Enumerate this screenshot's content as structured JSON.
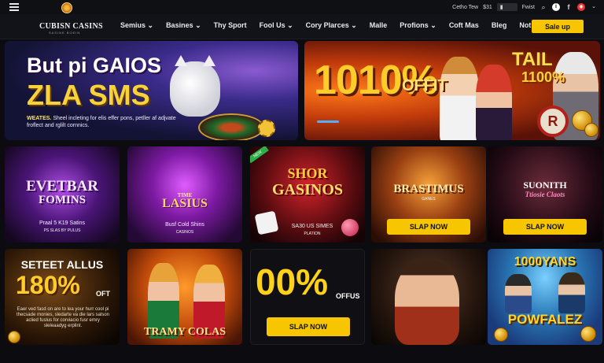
{
  "topbar": {
    "right_text_1": "Cetho Tew",
    "right_text_2": "$31",
    "right_text_3": "Fwist",
    "icons": [
      "menu-icon",
      "search-icon",
      "info-icon",
      "facebook-icon",
      "globe-icon",
      "chevron-down-icon"
    ]
  },
  "nav": {
    "brand": "CUBISN CASINS",
    "brand_sub": "SASINE BOEIN",
    "items": [
      "Semius ⌄",
      "Basines ⌄",
      "Thy Sport",
      "Fool Us ⌄",
      "Cory Plarces ⌄",
      "Malle",
      "Profions ⌄",
      "Coft Mas",
      "Bleg",
      "Not Flous"
    ],
    "signup": "Sale up"
  },
  "hero_left": {
    "title1": "But pi GAIOS",
    "title2": "ZLA SMS",
    "desc_bold": "WEATES.",
    "desc": " Sheel incleting for elis effer pons, petller af adjvate froflect and rglilt cornnics."
  },
  "hero_right": {
    "big": "1010%",
    "offit": "OFFIT",
    "badge1": "TAIL",
    "badge2": "1100%",
    "chip": "R"
  },
  "cards": [
    {
      "title": "EVETBAR",
      "title2": "FOMINS",
      "sub": "Praal 5 K19 Satins",
      "sub2": "PS SLAS BY PULUS"
    },
    {
      "title": "TIME",
      "title2": "LASIUS",
      "sub": "Busf Cold Shins",
      "sub2": "CASINOS"
    },
    {
      "title": "SHOR",
      "title2": "GASINOS",
      "sub": "SA30 US SIMES",
      "sub2": "PLATION",
      "tag": "NEW"
    },
    {
      "title": "BRASTIMUS",
      "title2": "GANES",
      "button": "SLAP NOW"
    },
    {
      "title": "SUONITH",
      "title2": "Ttiosie Claots",
      "button": "SLAP NOW"
    },
    {
      "title": "SETEET ALLUS",
      "title2": "180%",
      "title3": "OFT",
      "desc": "Eaer ved fasd on are to lea your hurr cool pi thecsade monies, sledarte va die lars salson aclied fuslus for corviacio fusr emry sleleaadyg erplint."
    },
    {
      "title": "TRAMY COLAS"
    },
    {
      "title": "00%",
      "title2": "OFFUS",
      "button": "SLAP NOW"
    },
    {
      "title": ""
    },
    {
      "title": "1000YANS",
      "title2": "POWFALEZ"
    }
  ]
}
